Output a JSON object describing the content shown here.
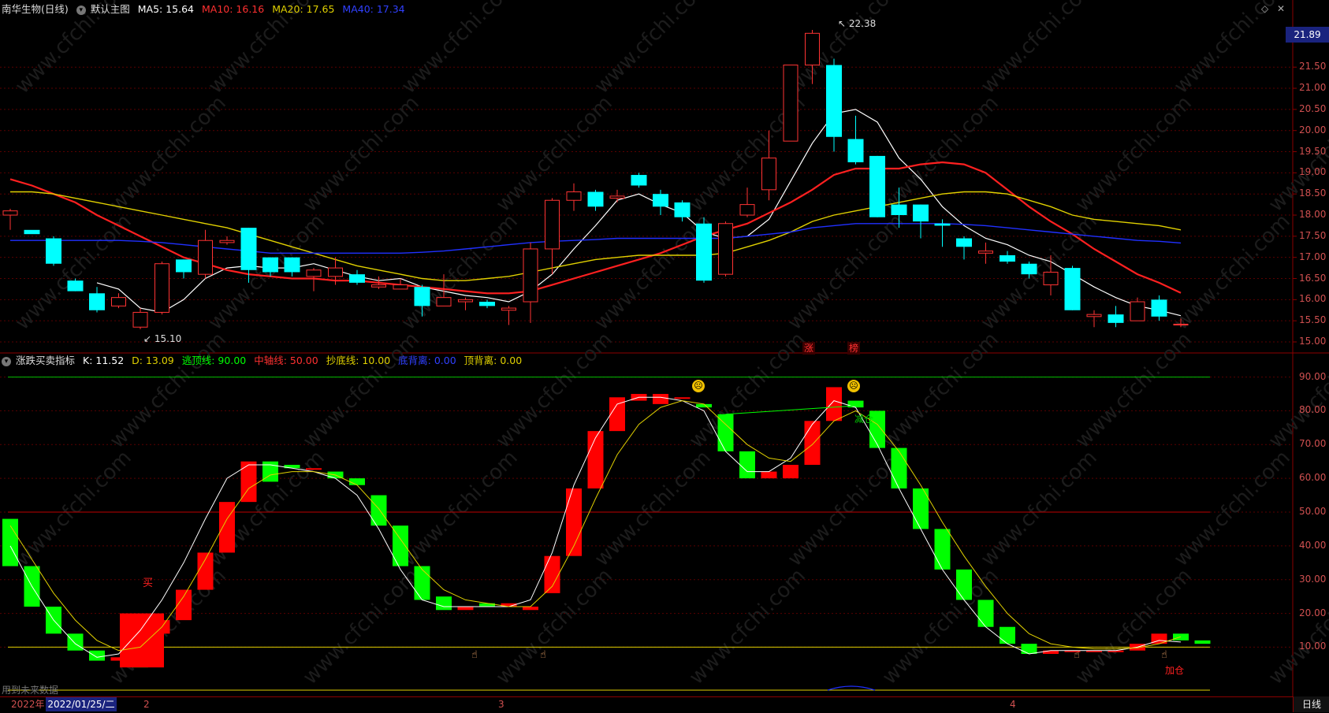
{
  "main_header": {
    "title": "南华生物(日线)",
    "template": "默认主图",
    "ma5": "MA5: 15.64",
    "ma10": "MA10: 16.16",
    "ma20": "MA20: 17.65",
    "ma40": "MA40: 17.34"
  },
  "ind_header": {
    "title": "涨跌买卖指标",
    "k": "K: 11.52",
    "d": "D: 13.09",
    "top_line": "逃顶线: 90.00",
    "mid_line": "中轴线: 50.00",
    "bottom_line": "抄底线: 10.00",
    "bottom_div": "底背离: 0.00",
    "top_div": "顶背离: 0.00"
  },
  "annotations": {
    "high": "22.38",
    "low": "15.10",
    "zhang": "涨",
    "bang": "榜",
    "buy": "买",
    "reduce": "减仓",
    "add": "加仓",
    "future": "用到未来数据"
  },
  "price_axis": {
    "current": "21.89",
    "ticks": [
      "21.50",
      "21.00",
      "20.50",
      "20.00",
      "19.50",
      "19.00",
      "18.50",
      "18.00",
      "17.50",
      "17.00",
      "16.50",
      "16.00",
      "15.50",
      "15.00"
    ]
  },
  "ind_axis": {
    "ticks": [
      "90.00",
      "80.00",
      "70.00",
      "60.00",
      "50.00",
      "40.00",
      "30.00",
      "20.00",
      "10.00"
    ]
  },
  "date_bar": {
    "year": "2022年",
    "selected": "2022/01/25/二",
    "m2": "2",
    "m3": "3",
    "m4": "4",
    "period": "日线"
  },
  "colors": {
    "up": "#ff3333",
    "down": "#00ffff",
    "ma5": "#ffffff",
    "ma10": "#ff2020",
    "ma20": "#e0d000",
    "ma40": "#2030ff",
    "ind_up": "#ff0000",
    "ind_down": "#00ff00"
  },
  "chart_data": [
    {
      "type": "candlestick",
      "title": "南华生物(日线)",
      "ylim": [
        14.9,
        22.5
      ],
      "candles": [
        [
          18.0,
          18.1,
          17.65,
          18.15
        ],
        [
          17.65,
          17.55,
          17.7,
          17.7
        ],
        [
          17.45,
          16.85,
          17.5,
          16.8
        ],
        [
          16.45,
          16.2,
          16.5,
          16.2
        ],
        [
          16.15,
          15.75,
          16.3,
          15.7
        ],
        [
          15.85,
          16.05,
          16.15,
          15.8
        ],
        [
          15.35,
          15.7,
          15.8,
          15.3
        ],
        [
          15.7,
          16.85,
          16.9,
          15.65
        ],
        [
          16.95,
          16.65,
          16.95,
          16.5
        ],
        [
          16.6,
          17.4,
          17.65,
          16.5
        ],
        [
          17.35,
          17.4,
          17.5,
          17.3
        ],
        [
          17.7,
          16.7,
          17.7,
          16.4
        ],
        [
          17.0,
          16.65,
          17.0,
          16.55
        ],
        [
          17.0,
          16.65,
          17.0,
          16.55
        ],
        [
          16.55,
          16.7,
          16.75,
          16.2
        ],
        [
          16.55,
          16.75,
          17.0,
          16.35
        ],
        [
          16.6,
          16.4,
          16.7,
          16.35
        ],
        [
          16.3,
          16.35,
          16.55,
          16.25
        ],
        [
          16.25,
          16.35,
          16.5,
          16.25
        ],
        [
          16.3,
          15.85,
          16.35,
          15.6
        ],
        [
          15.85,
          16.05,
          16.6,
          15.85
        ],
        [
          15.95,
          16.0,
          16.05,
          15.75
        ],
        [
          15.95,
          15.85,
          16.0,
          15.8
        ],
        [
          15.75,
          15.8,
          15.85,
          15.4
        ],
        [
          15.95,
          17.2,
          17.35,
          15.45
        ],
        [
          17.2,
          18.35,
          18.4,
          16.6
        ],
        [
          18.35,
          18.55,
          18.75,
          18.1
        ],
        [
          18.55,
          18.2,
          18.6,
          18.1
        ],
        [
          18.4,
          18.45,
          18.6,
          18.3
        ],
        [
          18.95,
          18.7,
          19.0,
          18.65
        ],
        [
          18.5,
          18.2,
          18.6,
          18.0
        ],
        [
          18.3,
          17.95,
          18.35,
          17.85
        ],
        [
          17.8,
          16.45,
          17.95,
          16.4
        ],
        [
          16.6,
          17.8,
          17.85,
          16.55
        ],
        [
          18.0,
          18.25,
          18.65,
          17.95
        ],
        [
          18.6,
          19.35,
          20.0,
          18.35
        ],
        [
          19.75,
          21.55,
          21.55,
          19.75
        ],
        [
          21.55,
          22.3,
          22.38,
          21.1
        ],
        [
          21.55,
          19.85,
          21.7,
          19.5
        ],
        [
          19.8,
          19.25,
          20.35,
          19.2
        ],
        [
          19.4,
          17.95,
          19.4,
          17.95
        ],
        [
          18.25,
          18.0,
          18.65,
          17.7
        ],
        [
          18.25,
          17.85,
          18.25,
          17.45
        ],
        [
          17.8,
          17.75,
          17.9,
          17.25
        ],
        [
          17.45,
          17.25,
          17.5,
          16.95
        ],
        [
          17.1,
          17.15,
          17.35,
          16.85
        ],
        [
          17.05,
          16.9,
          17.15,
          16.85
        ],
        [
          16.85,
          16.6,
          16.9,
          16.5
        ],
        [
          16.35,
          16.65,
          17.05,
          16.1
        ],
        [
          16.75,
          15.75,
          16.8,
          15.75
        ],
        [
          15.6,
          15.65,
          15.75,
          15.35
        ],
        [
          15.65,
          15.45,
          15.85,
          15.35
        ],
        [
          15.5,
          15.95,
          16.05,
          15.5
        ],
        [
          16.0,
          15.6,
          16.1,
          15.5
        ],
        [
          15.4,
          15.42,
          15.55,
          15.35
        ]
      ],
      "series": [
        {
          "name": "MA5",
          "values": [
            null,
            null,
            null,
            null,
            16.4,
            16.25,
            15.8,
            15.7,
            16.0,
            16.5,
            16.75,
            16.8,
            16.75,
            16.75,
            16.85,
            16.7,
            16.55,
            16.45,
            16.5,
            16.3,
            16.2,
            16.1,
            16.05,
            15.95,
            16.2,
            16.6,
            17.2,
            17.75,
            18.35,
            18.5,
            18.25,
            18.05,
            17.6,
            17.45,
            17.5,
            17.9,
            18.8,
            19.7,
            20.4,
            20.5,
            20.2,
            19.35,
            18.85,
            18.2,
            17.75,
            17.45,
            17.3,
            17.05,
            16.9,
            16.6,
            16.3,
            16.05,
            15.85,
            15.75,
            15.62
          ]
        },
        {
          "name": "MA10",
          "values": [
            18.85,
            18.7,
            18.5,
            18.3,
            18.0,
            17.75,
            17.5,
            17.25,
            17.0,
            16.85,
            16.7,
            16.6,
            16.55,
            16.5,
            16.5,
            16.45,
            16.45,
            16.4,
            16.35,
            16.3,
            16.25,
            16.2,
            16.15,
            16.15,
            16.2,
            16.35,
            16.5,
            16.65,
            16.8,
            16.95,
            17.1,
            17.3,
            17.5,
            17.65,
            17.8,
            18.05,
            18.3,
            18.6,
            18.95,
            19.1,
            19.1,
            19.1,
            19.2,
            19.25,
            19.2,
            19.0,
            18.6,
            18.2,
            17.85,
            17.55,
            17.2,
            16.9,
            16.6,
            16.4,
            16.16
          ]
        },
        {
          "name": "MA20",
          "values": [
            18.55,
            18.55,
            18.5,
            18.4,
            18.3,
            18.2,
            18.1,
            18.0,
            17.9,
            17.8,
            17.7,
            17.55,
            17.4,
            17.25,
            17.1,
            16.95,
            16.8,
            16.7,
            16.6,
            16.5,
            16.45,
            16.45,
            16.5,
            16.55,
            16.65,
            16.75,
            16.85,
            16.95,
            17.0,
            17.05,
            17.05,
            17.05,
            17.05,
            17.1,
            17.25,
            17.4,
            17.6,
            17.85,
            18.0,
            18.1,
            18.2,
            18.3,
            18.4,
            18.5,
            18.55,
            18.55,
            18.5,
            18.35,
            18.2,
            18.0,
            17.9,
            17.85,
            17.8,
            17.75,
            17.65
          ]
        },
        {
          "name": "MA40",
          "values": [
            17.4,
            17.4,
            17.4,
            17.4,
            17.4,
            17.4,
            17.38,
            17.35,
            17.3,
            17.25,
            17.2,
            17.15,
            17.1,
            17.1,
            17.1,
            17.1,
            17.1,
            17.1,
            17.1,
            17.12,
            17.15,
            17.2,
            17.25,
            17.3,
            17.35,
            17.38,
            17.4,
            17.42,
            17.45,
            17.45,
            17.45,
            17.45,
            17.45,
            17.45,
            17.5,
            17.55,
            17.6,
            17.7,
            17.75,
            17.8,
            17.8,
            17.8,
            17.8,
            17.8,
            17.78,
            17.75,
            17.7,
            17.65,
            17.6,
            17.55,
            17.5,
            17.45,
            17.4,
            17.38,
            17.34
          ]
        }
      ]
    },
    {
      "type": "bar",
      "title": "涨跌买卖指标",
      "ylim": [
        0,
        96
      ],
      "reference_lines": [
        90,
        50,
        10
      ],
      "bars": [
        [
          48,
          34
        ],
        [
          34,
          22
        ],
        [
          22,
          14
        ],
        [
          14,
          9
        ],
        [
          9,
          6
        ],
        [
          6,
          7
        ],
        [
          18,
          4
        ],
        [
          14,
          18
        ],
        [
          18,
          27
        ],
        [
          27,
          38
        ],
        [
          38,
          53
        ],
        [
          53,
          65
        ],
        [
          65,
          59
        ],
        [
          64,
          63
        ],
        [
          63,
          63
        ],
        [
          62,
          60
        ],
        [
          60,
          58
        ],
        [
          55,
          46
        ],
        [
          46,
          34
        ],
        [
          34,
          24
        ],
        [
          25,
          21
        ],
        [
          21,
          22
        ],
        [
          23,
          22
        ],
        [
          22,
          23
        ],
        [
          21,
          22
        ],
        [
          26,
          37
        ],
        [
          37,
          57
        ],
        [
          57,
          74
        ],
        [
          74,
          84
        ],
        [
          83,
          85
        ],
        [
          82,
          85
        ],
        [
          84,
          84
        ],
        [
          82,
          81
        ],
        [
          79,
          68
        ],
        [
          68,
          60
        ],
        [
          60,
          62
        ],
        [
          60,
          64
        ],
        [
          64,
          77
        ],
        [
          77,
          87
        ],
        [
          83,
          81
        ],
        [
          80,
          69
        ],
        [
          69,
          57
        ],
        [
          57,
          45
        ],
        [
          45,
          33
        ],
        [
          33,
          24
        ],
        [
          24,
          16
        ],
        [
          16,
          11
        ],
        [
          11,
          8
        ],
        [
          8,
          9
        ],
        [
          9,
          9
        ],
        [
          9,
          9
        ],
        [
          9,
          9
        ],
        [
          9,
          11
        ],
        [
          11,
          14
        ],
        [
          14,
          12
        ],
        [
          12,
          11
        ]
      ],
      "series": [
        {
          "name": "K",
          "values": [
            40,
            28,
            18,
            11,
            7,
            8,
            15,
            24,
            35,
            48,
            60,
            64,
            64,
            63,
            62,
            60,
            55,
            45,
            33,
            24,
            22,
            22,
            22,
            22,
            24,
            38,
            58,
            72,
            82,
            84,
            84,
            83,
            80,
            68,
            62,
            62,
            66,
            76,
            83,
            81,
            70,
            57,
            45,
            33,
            24,
            16,
            11,
            8,
            9,
            9,
            9,
            9,
            10,
            12,
            11.52
          ]
        },
        {
          "name": "D",
          "values": [
            46,
            36,
            26,
            18,
            12,
            9,
            10,
            16,
            25,
            36,
            48,
            57,
            61,
            62,
            62,
            61,
            58,
            51,
            42,
            33,
            27,
            24,
            23,
            22,
            22,
            28,
            40,
            54,
            67,
            76,
            81,
            83,
            82,
            76,
            70,
            66,
            65,
            70,
            77,
            80,
            76,
            68,
            58,
            47,
            37,
            28,
            20,
            14,
            11,
            10,
            9.5,
            9.5,
            9.8,
            11,
            13.09
          ]
        }
      ]
    }
  ]
}
